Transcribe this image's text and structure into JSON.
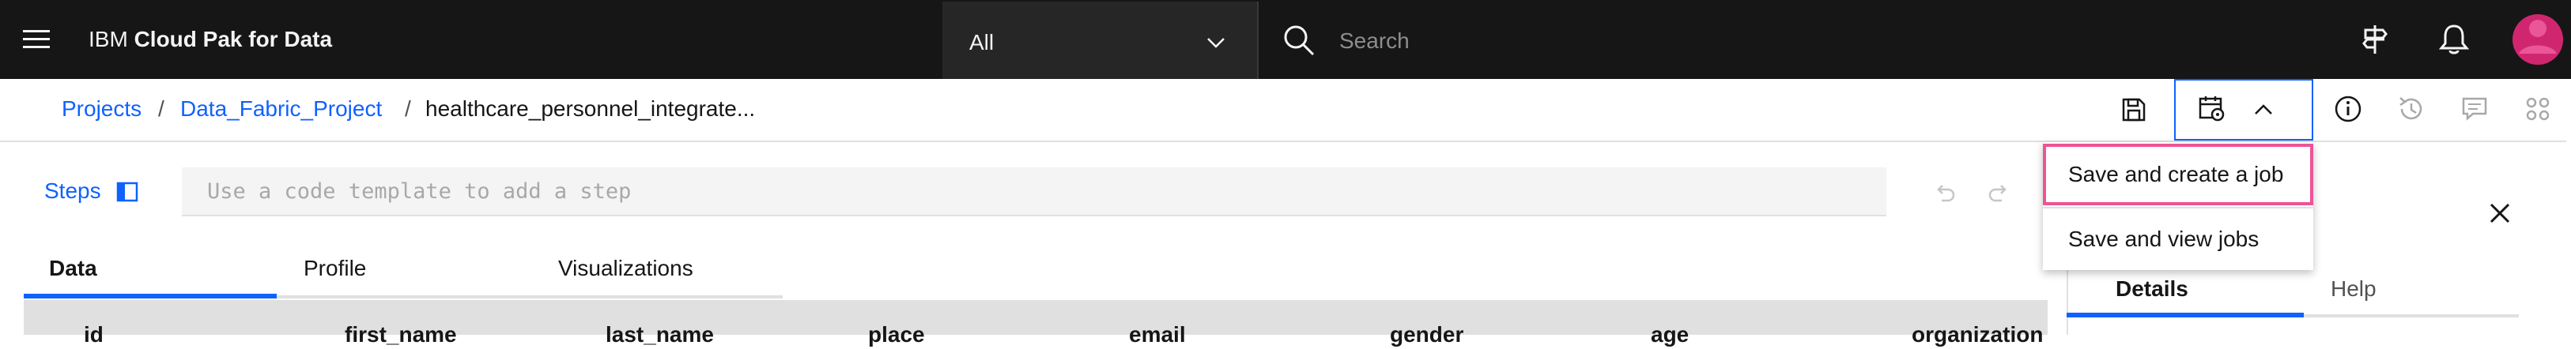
{
  "header": {
    "brand_prefix": "IBM ",
    "brand_name": "Cloud Pak for Data",
    "scope_value": "All",
    "search_placeholder": "Search"
  },
  "breadcrumb": {
    "items": [
      "Projects",
      "Data_Fabric_Project",
      "healthcare_personnel_integrate..."
    ],
    "separator": "/"
  },
  "steps": {
    "label": "Steps",
    "template_placeholder": "Use a code template to add a step"
  },
  "tabs": [
    "Data",
    "Profile",
    "Visualizations"
  ],
  "table": {
    "columns": [
      "id",
      "first_name",
      "last_name",
      "place",
      "email",
      "gender",
      "age",
      "organization"
    ]
  },
  "save_menu": {
    "items": [
      "Save and create a job",
      "Save and view jobs"
    ]
  },
  "side_panel": {
    "tabs": [
      "Details",
      "Help"
    ]
  },
  "colors": {
    "header_bg": "#161616",
    "accent": "#0f62fe",
    "highlight": "#ee5396",
    "avatar": "#d02670"
  },
  "icons": {
    "menu": "hamburger-icon",
    "search": "search-icon",
    "signpost": "signpost-icon",
    "notifications": "bell-icon",
    "save": "save-icon",
    "save_job": "calendar-settings-icon",
    "info": "info-icon",
    "history": "history-icon",
    "comments": "chat-icon",
    "details": "apps-icon",
    "close": "close-icon"
  }
}
